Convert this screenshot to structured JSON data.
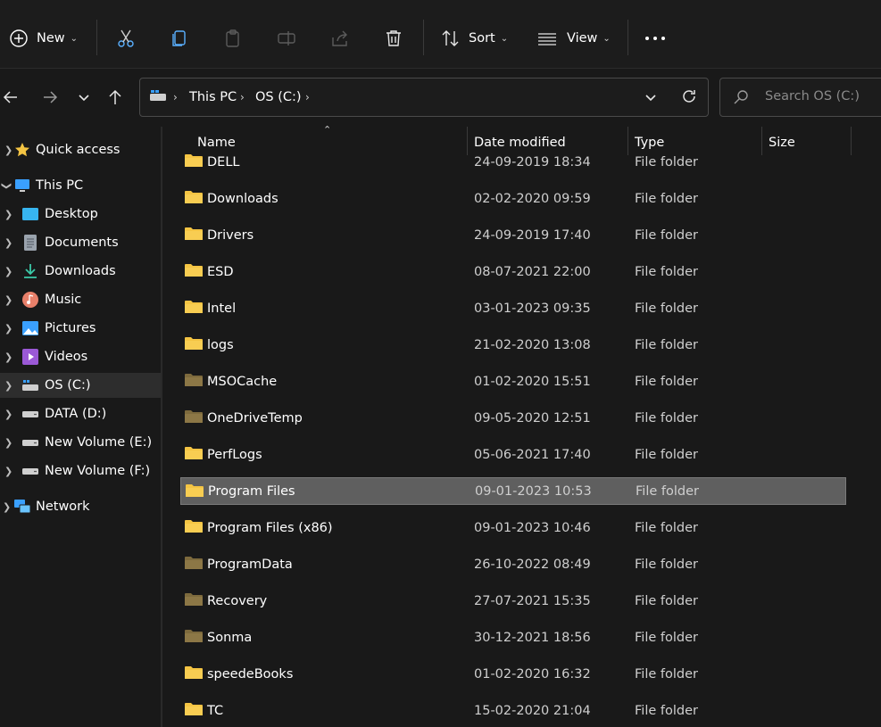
{
  "toolbar": {
    "new_label": "New",
    "sort_label": "Sort",
    "view_label": "View",
    "icons": [
      "plus-circle-icon",
      "cut-icon",
      "copy-icon",
      "paste-icon",
      "rename-icon",
      "share-icon",
      "delete-icon",
      "sort-icon",
      "view-icon",
      "more-icon"
    ]
  },
  "address": {
    "crumbs": [
      "This PC",
      "OS (C:)"
    ]
  },
  "search": {
    "placeholder": "Search OS (C:)"
  },
  "nav": {
    "items": [
      {
        "label": "Quick access"
      },
      {
        "label": "This PC"
      },
      {
        "label": "Desktop"
      },
      {
        "label": "Documents"
      },
      {
        "label": "Downloads"
      },
      {
        "label": "Music"
      },
      {
        "label": "Pictures"
      },
      {
        "label": "Videos"
      },
      {
        "label": "OS (C:)"
      },
      {
        "label": "DATA (D:)"
      },
      {
        "label": "New Volume (E:)"
      },
      {
        "label": "New Volume (F:)"
      },
      {
        "label": "Network"
      }
    ]
  },
  "columns": {
    "name": "Name",
    "date": "Date modified",
    "type": "Type",
    "size": "Size"
  },
  "files": [
    {
      "name": "DELL",
      "date": "24-09-2019 18:34",
      "type": "File folder"
    },
    {
      "name": "Downloads",
      "date": "02-02-2020 09:59",
      "type": "File folder"
    },
    {
      "name": "Drivers",
      "date": "24-09-2019 17:40",
      "type": "File folder"
    },
    {
      "name": "ESD",
      "date": "08-07-2021 22:00",
      "type": "File folder"
    },
    {
      "name": "Intel",
      "date": "03-01-2023 09:35",
      "type": "File folder"
    },
    {
      "name": "logs",
      "date": "21-02-2020 13:08",
      "type": "File folder"
    },
    {
      "name": "MSOCache",
      "date": "01-02-2020 15:51",
      "type": "File folder"
    },
    {
      "name": "OneDriveTemp",
      "date": "09-05-2020 12:51",
      "type": "File folder"
    },
    {
      "name": "PerfLogs",
      "date": "05-06-2021 17:40",
      "type": "File folder"
    },
    {
      "name": "Program Files",
      "date": "09-01-2023 10:53",
      "type": "File folder"
    },
    {
      "name": "Program Files (x86)",
      "date": "09-01-2023 10:46",
      "type": "File folder"
    },
    {
      "name": "ProgramData",
      "date": "26-10-2022 08:49",
      "type": "File folder"
    },
    {
      "name": "Recovery",
      "date": "27-07-2021 15:35",
      "type": "File folder"
    },
    {
      "name": "Sonma",
      "date": "30-12-2021 18:56",
      "type": "File folder"
    },
    {
      "name": "speedeBooks",
      "date": "01-02-2020 16:32",
      "type": "File folder"
    },
    {
      "name": "TC",
      "date": "15-02-2020 21:04",
      "type": "File folder"
    }
  ],
  "colors": {
    "folder": "#f4c443",
    "folder_hidden": "#8c7746",
    "selected_row": "#5f5f5f"
  }
}
